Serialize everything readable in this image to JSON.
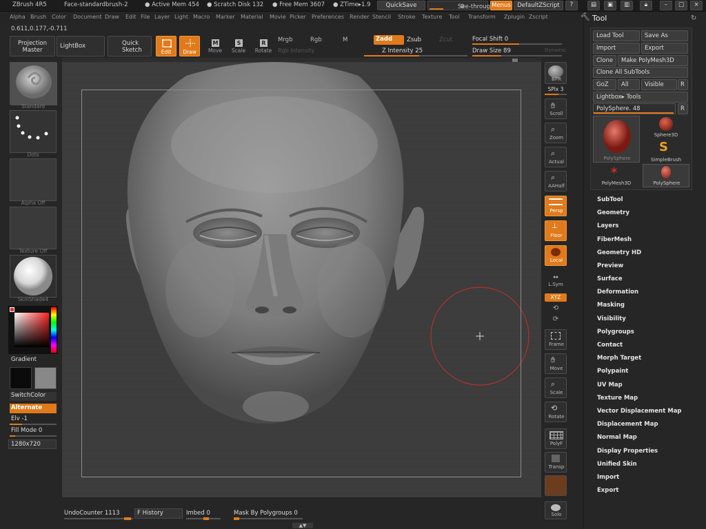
{
  "titlebar": {
    "app": "ZBrush 4R5",
    "doc": "Face-standardbrush-2",
    "active_mem": "● Active Mem 454",
    "scratch": "● Scratch Disk 132",
    "free_mem": "● Free Mem 3607",
    "ztime": "● ZTime▸1.9",
    "quicksave": "QuickSave",
    "seethrough": "See-through",
    "seethrough_val": "0",
    "menus": "Menus",
    "script": "DefaultZScript"
  },
  "menubar": [
    "Alpha",
    "Brush",
    "Color",
    "Document",
    "Draw",
    "Edit",
    "File",
    "Layer",
    "Light",
    "Macro",
    "Marker",
    "Material",
    "Movie",
    "Picker",
    "Preferences",
    "Render",
    "Stencil",
    "Stroke",
    "Texture",
    "Tool",
    "Transform",
    "Zplugin",
    "Zscript"
  ],
  "coords": "0.611,0.177,-0.711",
  "shelf": {
    "projection_master": "Projection Master",
    "lightbox": "LightBox",
    "quick_sketch": "Quick Sketch",
    "edit": "Edit",
    "draw": "Draw",
    "move": "Move",
    "scale": "Scale",
    "rotate": "Rotate",
    "mrgb": "Mrgb",
    "rgb": "Rgb",
    "m": "M",
    "rgb_intensity": "Rgb Intensity",
    "zadd": "Zadd",
    "zsub": "Zsub",
    "zcut": "Zcut",
    "z_intensity": "Z Intensity 25",
    "focal_shift": "Focal Shift 0",
    "draw_size": "Draw Size 89",
    "dynamic": "Dynamic"
  },
  "left": {
    "standard": "Standard",
    "dots": "Dots",
    "alpha_off": "Alpha Off",
    "texture_off": "Texture Off",
    "skinshade": "SkinShade4",
    "gradient": "Gradient",
    "switchcolor": "SwitchColor",
    "alternate": "Alternate",
    "elv": "Elv -1",
    "fill_mode": "Fill Mode 0",
    "doc_size": "1280x720"
  },
  "right_shelf": [
    {
      "label": "BPR",
      "icon": "bpr-icon"
    },
    {
      "label": "SPix 3",
      "icon": "spix-icon"
    },
    {
      "label": "Scroll",
      "icon": "scroll-icon"
    },
    {
      "label": "Zoom",
      "icon": "zoom-icon"
    },
    {
      "label": "Actual",
      "icon": "actual-icon"
    },
    {
      "label": "AAHalf",
      "icon": "aahalf-icon"
    },
    {
      "label": "Persp",
      "icon": "persp-icon"
    },
    {
      "label": "Floor",
      "icon": "floor-icon"
    },
    {
      "label": "Local",
      "icon": "local-icon"
    },
    {
      "label": "L.Sym",
      "icon": "lsym-icon"
    },
    {
      "label": "XYZ",
      "icon": "xyz-icon"
    },
    {
      "label": "Frame",
      "icon": "frame-icon"
    },
    {
      "label": "Move",
      "icon": "move-icon"
    },
    {
      "label": "Scale",
      "icon": "scale-icon"
    },
    {
      "label": "Rotate",
      "icon": "rotate-icon"
    },
    {
      "label": "PolyF",
      "icon": "polyf-icon"
    },
    {
      "label": "Transp",
      "icon": "transp-icon"
    },
    {
      "label": "Solo",
      "icon": "solo-icon"
    }
  ],
  "tool": {
    "title": "Tool",
    "load_tool": "Load Tool",
    "save_as": "Save As",
    "import": "Import",
    "export": "Export",
    "clone": "Clone",
    "make_polymesh": "Make PolyMesh3D",
    "clone_all": "Clone All SubTools",
    "goz": "GoZ",
    "all": "All",
    "visible": "Visible",
    "r": "R",
    "lightbox_tools": "Lightbox▸ Tools",
    "polysphere_slider": "PolySphere. 48",
    "thumbs": [
      "PolySphere",
      "Sphere3D",
      "SimpleBrush",
      "PolyMesh3D",
      "PolySphere"
    ],
    "menu": [
      "SubTool",
      "Geometry",
      "Layers",
      "FiberMesh",
      "Geometry HD",
      "Preview",
      "Surface",
      "Deformation",
      "Masking",
      "Visibility",
      "Polygroups",
      "Contact",
      "Morph Target",
      "Polypaint",
      "UV Map",
      "Texture Map",
      "Vector Displacement Map",
      "Displacement Map",
      "Normal Map",
      "Display Properties",
      "Unified Skin",
      "Import",
      "Export"
    ]
  },
  "bottom": {
    "undo": "UndoCounter 1113",
    "history": "F History",
    "imbed": "Imbed 0",
    "mask_by_polygroups": "Mask By Polygroups 0"
  },
  "colors": {
    "accent": "#e07a1a",
    "bg": "#262626",
    "canvas": "#3d3d3d"
  }
}
